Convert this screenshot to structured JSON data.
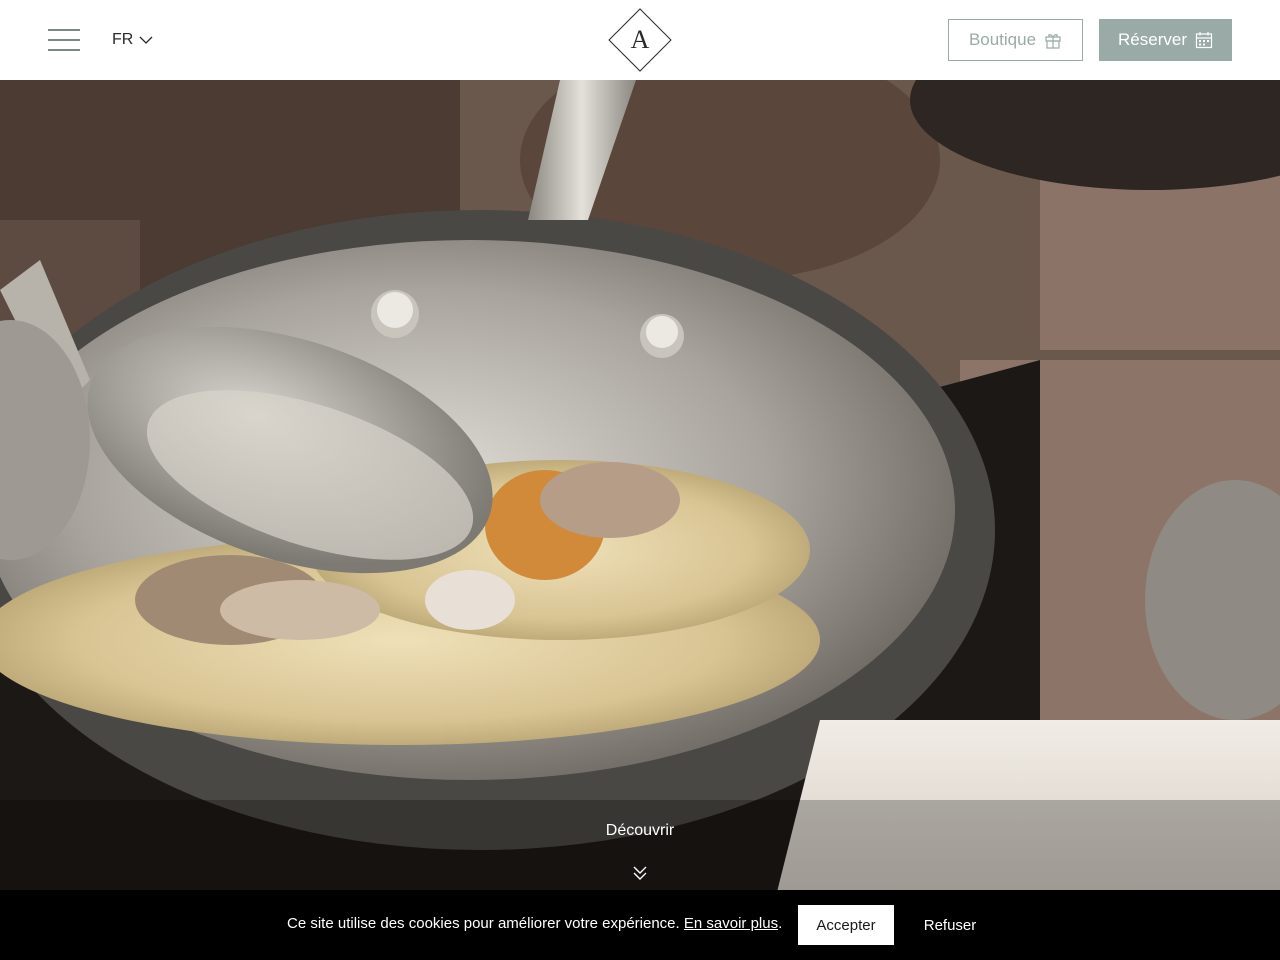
{
  "header": {
    "language": "FR",
    "logo_letter": "A",
    "boutique_label": "Boutique",
    "reserve_label": "Réserver"
  },
  "hero": {
    "discover_label": "Découvrir"
  },
  "cookie_bar": {
    "message": "Ce site utilise des cookies pour améliorer votre expérience.",
    "learn_more": "En savoir plus",
    "period": ".",
    "accept_label": "Accepter",
    "refuse_label": "Refuser"
  },
  "colors": {
    "accent": "#9aaba7",
    "header_bg": "#ffffff",
    "cookie_bg": "#000000"
  },
  "icons": {
    "menu": "hamburger-icon",
    "language": "chevron-down-icon",
    "boutique": "gift-icon",
    "reserve": "calendar-icon",
    "discover": "double-chevron-down-icon"
  }
}
